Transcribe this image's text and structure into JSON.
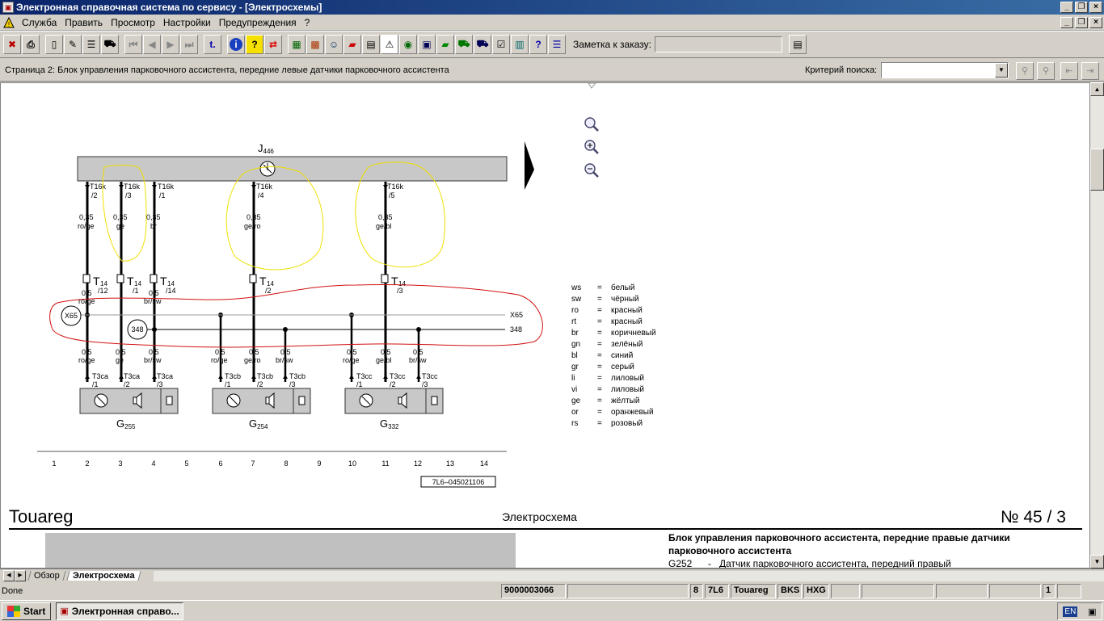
{
  "window": {
    "title": "Электронная справочная система по сервису - [Электросхемы]",
    "buttons": [
      "_",
      "❐",
      "×"
    ]
  },
  "menu": {
    "items": [
      "Служба",
      "Править",
      "Просмотр",
      "Настройки",
      "Предупреждения",
      "?"
    ]
  },
  "toolbar": {
    "buttons": [
      "exit-icon",
      "print-icon",
      "new-doc-icon",
      "edit-doc-icon",
      "list-icon",
      "car-icon",
      "first-page-icon",
      "prev-page-icon",
      "next-page-icon",
      "last-page-icon",
      "jump-back-icon",
      "info-icon",
      "help-icon",
      "swap-icon",
      "calc-icon",
      "grid-icon",
      "people-icon",
      "book-icon",
      "document-icon",
      "warning-icon",
      "globe-icon",
      "save-icon",
      "green-book-icon",
      "car-small-icon",
      "car-info-icon",
      "checklist-icon",
      "books-icon",
      "help-book-icon",
      "globe-stripe-icon"
    ],
    "order_note_label": "Заметка к заказу:",
    "order_note_value": ""
  },
  "infobar": {
    "page_text": "Страница 2: Блок управления парковочного ассистента, передние левые датчики парковочного ассистента",
    "search_label": "Критерий поиска:",
    "search_value": ""
  },
  "diagram": {
    "control_unit": {
      "letter": "J",
      "sub": "446"
    },
    "pins_top": [
      {
        "conn": "T16k",
        "pin": "/2",
        "size": "0,35",
        "color": "ro/ge"
      },
      {
        "conn": "T16k",
        "pin": "/3",
        "size": "0,35",
        "color": "ge"
      },
      {
        "conn": "T16k",
        "pin": "/1",
        "size": "0,35",
        "color": "br"
      },
      {
        "conn": "T16k",
        "pin": "/4",
        "size": "0,35",
        "color": "ge/ro"
      },
      {
        "conn": "T16k",
        "pin": "/5",
        "size": "0,35",
        "color": "ge/bl"
      }
    ],
    "t14": [
      {
        "name": "T",
        "sub": "14",
        "pin": "/12",
        "size": "0,5",
        "color": "ro/ge"
      },
      {
        "name": "T",
        "sub": "14",
        "pin": "/1",
        "size": "",
        "color": ""
      },
      {
        "name": "T",
        "sub": "14",
        "pin": "/14",
        "size": "0,5",
        "color": "br/sw"
      },
      {
        "name": "T",
        "sub": "14",
        "pin": "/2",
        "size": "",
        "color": ""
      },
      {
        "name": "T",
        "sub": "14",
        "pin": "/3",
        "size": "",
        "color": ""
      }
    ],
    "bus": {
      "x65": "X65",
      "b348": "348"
    },
    "lower_wires": [
      {
        "size": "0,5",
        "color": "ro/ge"
      },
      {
        "size": "0,5",
        "color": "ge"
      },
      {
        "size": "0,5",
        "color": "br/sw"
      },
      {
        "size": "0,5",
        "color": "ro/ge"
      },
      {
        "size": "0,5",
        "color": "ge/ro"
      },
      {
        "size": "0,5",
        "color": "br/sw"
      },
      {
        "size": "0,5",
        "color": "ro/ge"
      },
      {
        "size": "0,5",
        "color": "ge/bl"
      },
      {
        "size": "0,5",
        "color": "br/sw"
      }
    ],
    "sensor_conns": [
      {
        "conn": "T3ca",
        "pin": "/1"
      },
      {
        "conn": "T3ca",
        "pin": "/2"
      },
      {
        "conn": "T3ca",
        "pin": "/3"
      },
      {
        "conn": "T3cb",
        "pin": "/1"
      },
      {
        "conn": "T3cb",
        "pin": "/2"
      },
      {
        "conn": "T3cb",
        "pin": "/3"
      },
      {
        "conn": "T3cc",
        "pin": "/1"
      },
      {
        "conn": "T3cc",
        "pin": "/2"
      },
      {
        "conn": "T3cc",
        "pin": "/3"
      }
    ],
    "sensors": [
      {
        "letter": "G",
        "sub": "255"
      },
      {
        "letter": "G",
        "sub": "254"
      },
      {
        "letter": "G",
        "sub": "332"
      }
    ],
    "columns": [
      "1",
      "2",
      "3",
      "4",
      "5",
      "6",
      "7",
      "8",
      "9",
      "10",
      "11",
      "12",
      "13",
      "14"
    ],
    "diagram_id": "7L6–045021106"
  },
  "legend": [
    {
      "code": "ws",
      "eq": "=",
      "name": "белый"
    },
    {
      "code": "sw",
      "eq": "=",
      "name": "чёрный"
    },
    {
      "code": "ro",
      "eq": "=",
      "name": "красный"
    },
    {
      "code": "rt",
      "eq": "=",
      "name": "красный"
    },
    {
      "code": "br",
      "eq": "=",
      "name": "коричневый"
    },
    {
      "code": "gn",
      "eq": "=",
      "name": "зелёный"
    },
    {
      "code": "bl",
      "eq": "=",
      "name": "синий"
    },
    {
      "code": "gr",
      "eq": "=",
      "name": "серый"
    },
    {
      "code": "li",
      "eq": "=",
      "name": "лиловый"
    },
    {
      "code": "vi",
      "eq": "=",
      "name": "лиловый"
    },
    {
      "code": "ge",
      "eq": "=",
      "name": "жёлтый"
    },
    {
      "code": "or",
      "eq": "=",
      "name": "оранжевый"
    },
    {
      "code": "rs",
      "eq": "=",
      "name": "розовый"
    }
  ],
  "page_footer": {
    "model": "Touareg",
    "section": "Электросхема",
    "number": "№  45 / 3"
  },
  "next_page": {
    "heading": "Блок управления парковочного ассистента, передние правые датчики парковочного ассистента",
    "line_code": "G252",
    "line_dash": "-",
    "line_text": "Датчик парковочного ассистента, передний правый"
  },
  "tabs": [
    "Обзор",
    "Электросхема"
  ],
  "status": {
    "text": "Done",
    "order": "9000003066",
    "f1": "8",
    "f2": "7L6",
    "f3": "Touareg",
    "f4": "BKS",
    "f5": "HXG",
    "page": "1"
  },
  "taskbar": {
    "start": "Start",
    "task": "Электронная справо...",
    "lang": "EN"
  },
  "colors": {
    "annot_yellow": "#f0e000",
    "annot_red": "#d21010",
    "titlebar": "#0a246a"
  }
}
